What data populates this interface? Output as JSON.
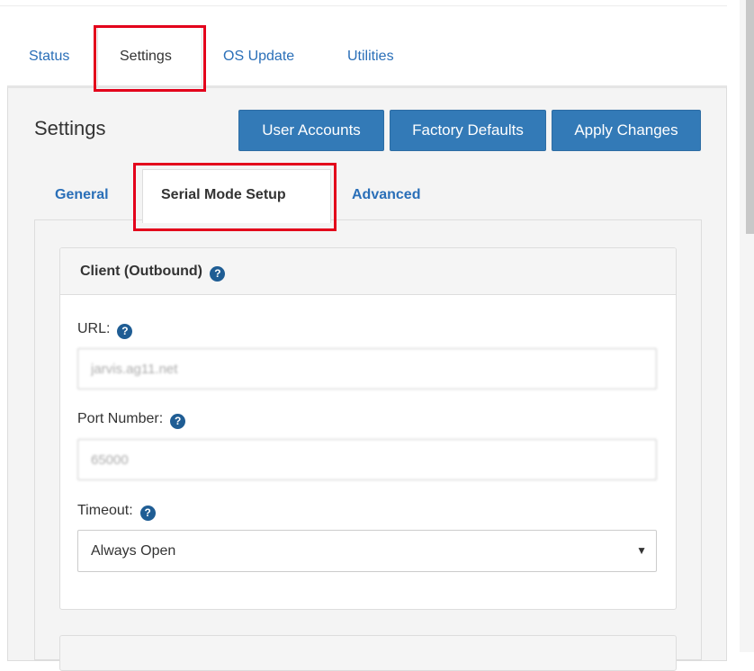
{
  "top_tabs": [
    {
      "label": "Status"
    },
    {
      "label": "Settings"
    },
    {
      "label": "OS Update"
    },
    {
      "label": "Utilities"
    }
  ],
  "active_top_tab": "Settings",
  "page": {
    "title": "Settings"
  },
  "actions": {
    "user_accounts": "User Accounts",
    "factory_defaults": "Factory Defaults",
    "apply_changes": "Apply Changes"
  },
  "sub_tabs": [
    {
      "label": "General"
    },
    {
      "label": "Serial Mode Setup"
    },
    {
      "label": "Advanced"
    }
  ],
  "active_sub_tab": "Serial Mode Setup",
  "client_section": {
    "title": "Client (Outbound)",
    "url": {
      "label": "URL:",
      "value": "jarvis.ag11.net"
    },
    "port": {
      "label": "Port Number:",
      "value": "65000"
    },
    "timeout": {
      "label": "Timeout:",
      "selected": "Always Open"
    }
  },
  "icons": {
    "help": "question-circle-icon",
    "dropdown": "caret-down-icon"
  },
  "colors": {
    "primary": "#337ab7",
    "link": "#2a6fb8",
    "highlight": "#e3001b",
    "help_icon": "#1f5d94"
  }
}
